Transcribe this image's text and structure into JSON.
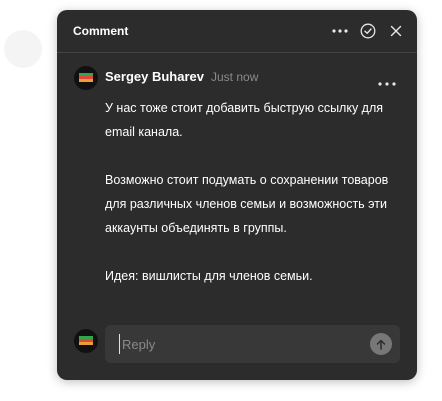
{
  "colors": {
    "panel_bg": "#2c2c2c",
    "reply_bg": "#383838",
    "muted_text": "#8a8a8a",
    "avatar_stripe_top": "#2ea84a",
    "avatar_stripe_mid": "#e0463a",
    "avatar_stripe_bot": "#e8a035"
  },
  "header": {
    "title": "Comment",
    "icons": [
      "more-horizontal-icon",
      "check-circle-icon",
      "close-icon"
    ]
  },
  "comment": {
    "author": "Sergey Buharev",
    "time": "Just now",
    "more_icon": "more-horizontal-icon",
    "paragraphs": [
      "У нас тоже стоит добавить быструю ссылку для email канала.",
      "Возможно стоит подумать о сохранении товаров для различных членов семьи и возможность эти аккаунты объединять в группы.",
      "Идея: вишлисты для членов семьи."
    ]
  },
  "reply": {
    "placeholder": "Reply",
    "value": "",
    "send_icon": "arrow-up-icon"
  }
}
